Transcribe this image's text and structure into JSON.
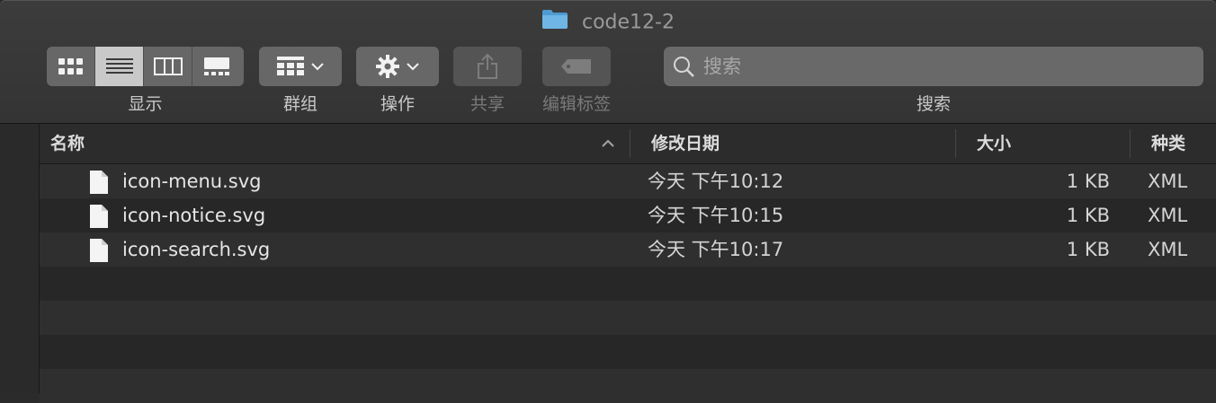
{
  "window": {
    "title": "code12-2"
  },
  "toolbar": {
    "view_label": "显示",
    "view_modes": [
      "icon-view-icon",
      "list-view-icon",
      "column-view-icon",
      "gallery-view-icon"
    ],
    "active_view": 1,
    "group_label": "群组",
    "action_label": "操作",
    "share_label": "共享",
    "tags_label": "编辑标签",
    "search_label": "搜索",
    "search_placeholder": "搜索",
    "search_value": ""
  },
  "columns": {
    "name": "名称",
    "date": "修改日期",
    "size": "大小",
    "kind": "种类"
  },
  "files": [
    {
      "name": "icon-menu.svg",
      "date": "今天 下午10:12",
      "size": "1 KB",
      "kind": "XML"
    },
    {
      "name": "icon-notice.svg",
      "date": "今天 下午10:15",
      "size": "1 KB",
      "kind": "XML"
    },
    {
      "name": "icon-search.svg",
      "date": "今天 下午10:17",
      "size": "1 KB",
      "kind": "XML"
    }
  ],
  "colors": {
    "toolbar": "#383838",
    "row_odd": "#2f2f2f",
    "row_even": "#272727",
    "folder": "#5aa4d6"
  }
}
